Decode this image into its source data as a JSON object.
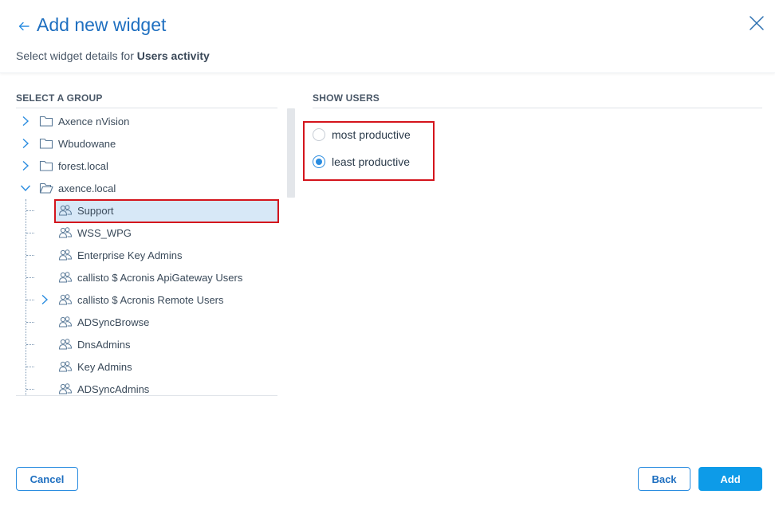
{
  "header": {
    "title": "Add new widget",
    "subtitle_prefix": "Select widget details for ",
    "subtitle_bold": "Users activity"
  },
  "left": {
    "section_label": "SELECT A GROUP",
    "tree": [
      {
        "label": "Axence nVision",
        "kind": "folder",
        "expanded": false
      },
      {
        "label": "Wbudowane",
        "kind": "folder",
        "expanded": false
      },
      {
        "label": "forest.local",
        "kind": "folder",
        "expanded": false
      },
      {
        "label": "axence.local",
        "kind": "folder",
        "expanded": true
      },
      {
        "label": "Support",
        "kind": "group",
        "selected": true
      },
      {
        "label": "WSS_WPG",
        "kind": "group"
      },
      {
        "label": "Enterprise Key Admins",
        "kind": "group"
      },
      {
        "label": "callisto $ Acronis ApiGateway Users",
        "kind": "group"
      },
      {
        "label": "callisto $ Acronis Remote Users",
        "kind": "group",
        "has_children": true
      },
      {
        "label": "ADSyncBrowse",
        "kind": "group"
      },
      {
        "label": "DnsAdmins",
        "kind": "group"
      },
      {
        "label": "Key Admins",
        "kind": "group"
      },
      {
        "label": "ADSyncAdmins",
        "kind": "group"
      }
    ]
  },
  "right": {
    "section_label": "SHOW USERS",
    "options": [
      {
        "label": "most productive",
        "checked": false
      },
      {
        "label": "least productive",
        "checked": true
      }
    ]
  },
  "footer": {
    "cancel_label": "Cancel",
    "back_label": "Back",
    "add_label": "Add"
  },
  "colors": {
    "accent": "#1e6fc0",
    "primary_button": "#0d9be8",
    "highlight_outline": "#d4141c",
    "selected_row": "#d7e8f7"
  }
}
